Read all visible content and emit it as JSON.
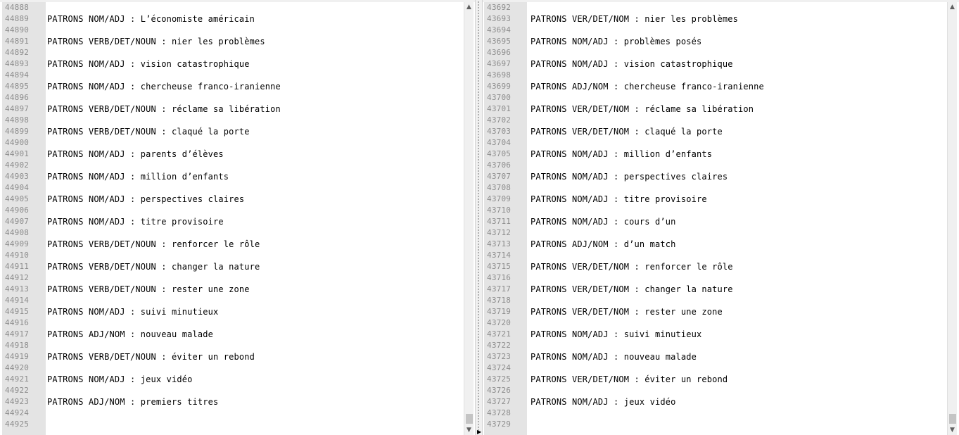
{
  "left_pane": {
    "lines": [
      {
        "num": "44888",
        "text": ""
      },
      {
        "num": "44889",
        "text": "PATRONS NOM/ADJ : L’économiste américain"
      },
      {
        "num": "44890",
        "text": ""
      },
      {
        "num": "44891",
        "text": "PATRONS VERB/DET/NOUN : nier les problèmes"
      },
      {
        "num": "44892",
        "text": ""
      },
      {
        "num": "44893",
        "text": "PATRONS NOM/ADJ : vision catastrophique"
      },
      {
        "num": "44894",
        "text": ""
      },
      {
        "num": "44895",
        "text": "PATRONS NOM/ADJ : chercheuse franco-iranienne"
      },
      {
        "num": "44896",
        "text": ""
      },
      {
        "num": "44897",
        "text": "PATRONS VERB/DET/NOUN : réclame sa libération"
      },
      {
        "num": "44898",
        "text": ""
      },
      {
        "num": "44899",
        "text": "PATRONS VERB/DET/NOUN : claqué la porte"
      },
      {
        "num": "44900",
        "text": ""
      },
      {
        "num": "44901",
        "text": "PATRONS NOM/ADJ : parents d’élèves"
      },
      {
        "num": "44902",
        "text": ""
      },
      {
        "num": "44903",
        "text": "PATRONS NOM/ADJ : million d’enfants"
      },
      {
        "num": "44904",
        "text": ""
      },
      {
        "num": "44905",
        "text": "PATRONS NOM/ADJ : perspectives claires"
      },
      {
        "num": "44906",
        "text": ""
      },
      {
        "num": "44907",
        "text": "PATRONS NOM/ADJ : titre provisoire"
      },
      {
        "num": "44908",
        "text": ""
      },
      {
        "num": "44909",
        "text": "PATRONS VERB/DET/NOUN : renforcer le rôle"
      },
      {
        "num": "44910",
        "text": ""
      },
      {
        "num": "44911",
        "text": "PATRONS VERB/DET/NOUN : changer la nature"
      },
      {
        "num": "44912",
        "text": ""
      },
      {
        "num": "44913",
        "text": "PATRONS VERB/DET/NOUN : rester une zone"
      },
      {
        "num": "44914",
        "text": ""
      },
      {
        "num": "44915",
        "text": "PATRONS NOM/ADJ : suivi minutieux"
      },
      {
        "num": "44916",
        "text": ""
      },
      {
        "num": "44917",
        "text": "PATRONS ADJ/NOM : nouveau malade"
      },
      {
        "num": "44918",
        "text": ""
      },
      {
        "num": "44919",
        "text": "PATRONS VERB/DET/NOUN : éviter un rebond"
      },
      {
        "num": "44920",
        "text": ""
      },
      {
        "num": "44921",
        "text": "PATRONS NOM/ADJ : jeux vidéo"
      },
      {
        "num": "44922",
        "text": ""
      },
      {
        "num": "44923",
        "text": "PATRONS ADJ/NOM : premiers titres"
      },
      {
        "num": "44924",
        "text": ""
      },
      {
        "num": "44925",
        "text": ""
      }
    ]
  },
  "right_pane": {
    "lines": [
      {
        "num": "43692",
        "text": ""
      },
      {
        "num": "43693",
        "text": "PATRONS VER/DET/NOM : nier les problèmes"
      },
      {
        "num": "43694",
        "text": ""
      },
      {
        "num": "43695",
        "text": "PATRONS NOM/ADJ : problèmes posés"
      },
      {
        "num": "43696",
        "text": ""
      },
      {
        "num": "43697",
        "text": "PATRONS NOM/ADJ : vision catastrophique"
      },
      {
        "num": "43698",
        "text": ""
      },
      {
        "num": "43699",
        "text": "PATRONS ADJ/NOM : chercheuse franco-iranienne"
      },
      {
        "num": "43700",
        "text": ""
      },
      {
        "num": "43701",
        "text": "PATRONS VER/DET/NOM : réclame sa libération"
      },
      {
        "num": "43702",
        "text": ""
      },
      {
        "num": "43703",
        "text": "PATRONS VER/DET/NOM : claqué la porte"
      },
      {
        "num": "43704",
        "text": ""
      },
      {
        "num": "43705",
        "text": "PATRONS NOM/ADJ : million d’enfants"
      },
      {
        "num": "43706",
        "text": ""
      },
      {
        "num": "43707",
        "text": "PATRONS NOM/ADJ : perspectives claires"
      },
      {
        "num": "43708",
        "text": ""
      },
      {
        "num": "43709",
        "text": "PATRONS NOM/ADJ : titre provisoire"
      },
      {
        "num": "43710",
        "text": ""
      },
      {
        "num": "43711",
        "text": "PATRONS NOM/ADJ : cours d’un"
      },
      {
        "num": "43712",
        "text": ""
      },
      {
        "num": "43713",
        "text": "PATRONS ADJ/NOM : d’un match"
      },
      {
        "num": "43714",
        "text": ""
      },
      {
        "num": "43715",
        "text": "PATRONS VER/DET/NOM : renforcer le rôle"
      },
      {
        "num": "43716",
        "text": ""
      },
      {
        "num": "43717",
        "text": "PATRONS VER/DET/NOM : changer la nature"
      },
      {
        "num": "43718",
        "text": ""
      },
      {
        "num": "43719",
        "text": "PATRONS VER/DET/NOM : rester une zone"
      },
      {
        "num": "43720",
        "text": ""
      },
      {
        "num": "43721",
        "text": "PATRONS NOM/ADJ : suivi minutieux"
      },
      {
        "num": "43722",
        "text": ""
      },
      {
        "num": "43723",
        "text": "PATRONS NOM/ADJ : nouveau malade"
      },
      {
        "num": "43724",
        "text": ""
      },
      {
        "num": "43725",
        "text": "PATRONS VER/DET/NOM : éviter un rebond"
      },
      {
        "num": "43726",
        "text": ""
      },
      {
        "num": "43727",
        "text": "PATRONS NOM/ADJ : jeux vidéo"
      },
      {
        "num": "43728",
        "text": ""
      },
      {
        "num": "43729",
        "text": ""
      }
    ]
  },
  "icons": {
    "scroll_up": "scroll-up-arrow-icon",
    "scroll_down": "scroll-down-arrow-icon",
    "splitter": "splitter-arrow-icon"
  },
  "colors": {
    "gutter_bg": "#e4e4e4",
    "line_number": "#8c8c8c",
    "text": "#000000",
    "scrollbar_bg": "#f0f0f0",
    "scrollbar_thumb": "#c4c4c4"
  }
}
